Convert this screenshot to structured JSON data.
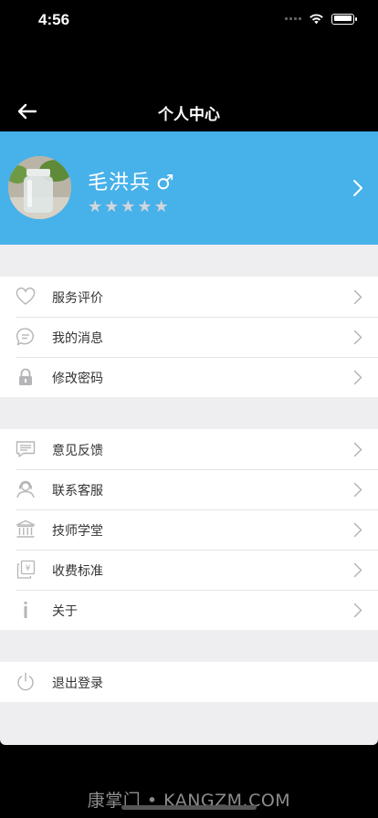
{
  "status_bar": {
    "time": "4:56"
  },
  "navbar": {
    "title": "个人中心"
  },
  "profile": {
    "name": "毛洪兵",
    "gender_symbol": "♂",
    "rating_stars": 5,
    "rating_filled": 0
  },
  "menu_group_1": [
    {
      "label": "服务评价",
      "icon": "heart-outline-icon"
    },
    {
      "label": "我的消息",
      "icon": "chat-bubble-icon"
    },
    {
      "label": "修改密码",
      "icon": "lock-icon"
    }
  ],
  "menu_group_2": [
    {
      "label": "意见反馈",
      "icon": "feedback-message-icon"
    },
    {
      "label": "联系客服",
      "icon": "customer-service-icon"
    },
    {
      "label": "技师学堂",
      "icon": "school-building-icon"
    },
    {
      "label": "收费标准",
      "icon": "price-yen-icon"
    },
    {
      "label": "关于",
      "icon": "info-icon"
    }
  ],
  "menu_group_3": [
    {
      "label": "退出登录",
      "icon": "power-icon"
    }
  ],
  "watermark": "康掌门 • KANGZM.COM",
  "colors": {
    "header_blue": "#47b1ea",
    "background": "#eeeef0",
    "icon_gray": "#b5b5b8"
  }
}
